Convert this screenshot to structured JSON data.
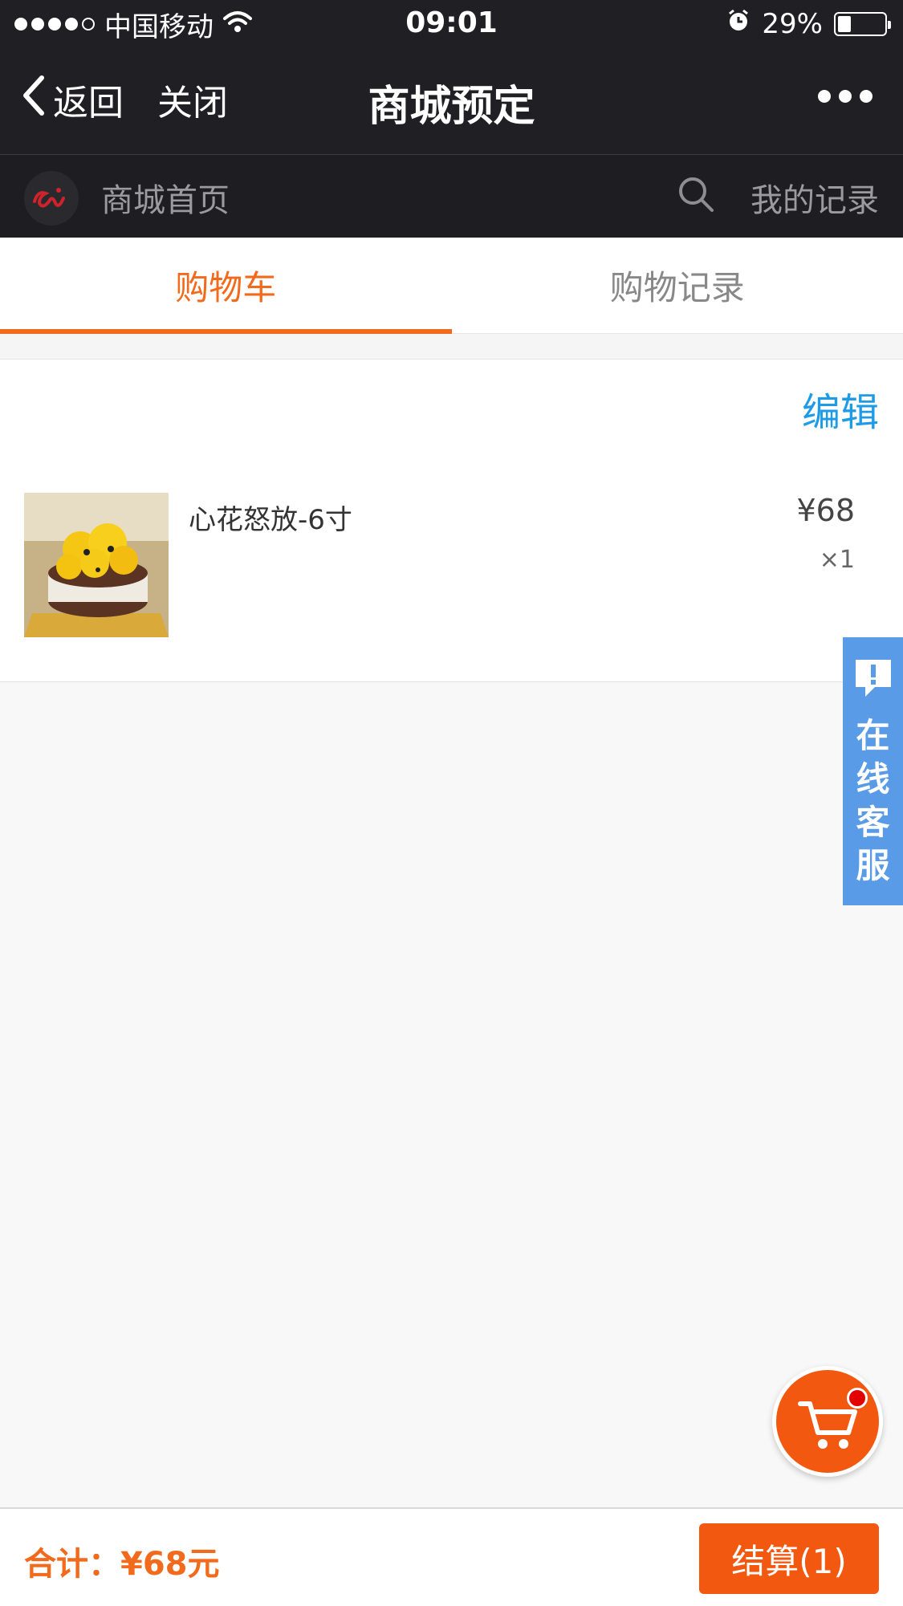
{
  "status_bar": {
    "carrier": "中国移动",
    "time": "09:01",
    "battery": "29%",
    "battery_level": 0.29
  },
  "nav": {
    "back_label": "返回",
    "close_label": "关闭",
    "title": "商城预定"
  },
  "subbar": {
    "home_label": "商城首页",
    "records_label": "我的记录"
  },
  "tabs": [
    {
      "label": "购物车",
      "active": true
    },
    {
      "label": "购物记录",
      "active": false
    }
  ],
  "cart": {
    "edit_label": "编辑",
    "items": [
      {
        "name": "心花怒放-6寸",
        "price": "¥68",
        "qty": "×1"
      }
    ]
  },
  "service": {
    "label_chars": [
      "在",
      "线",
      "客",
      "服"
    ]
  },
  "footer": {
    "total": "合计：¥68元",
    "checkout_label": "结算(1)"
  },
  "colors": {
    "accent": "#f26a1b",
    "link": "#1e9be6",
    "service": "#5a9be8",
    "dark": "#1f1f24"
  }
}
